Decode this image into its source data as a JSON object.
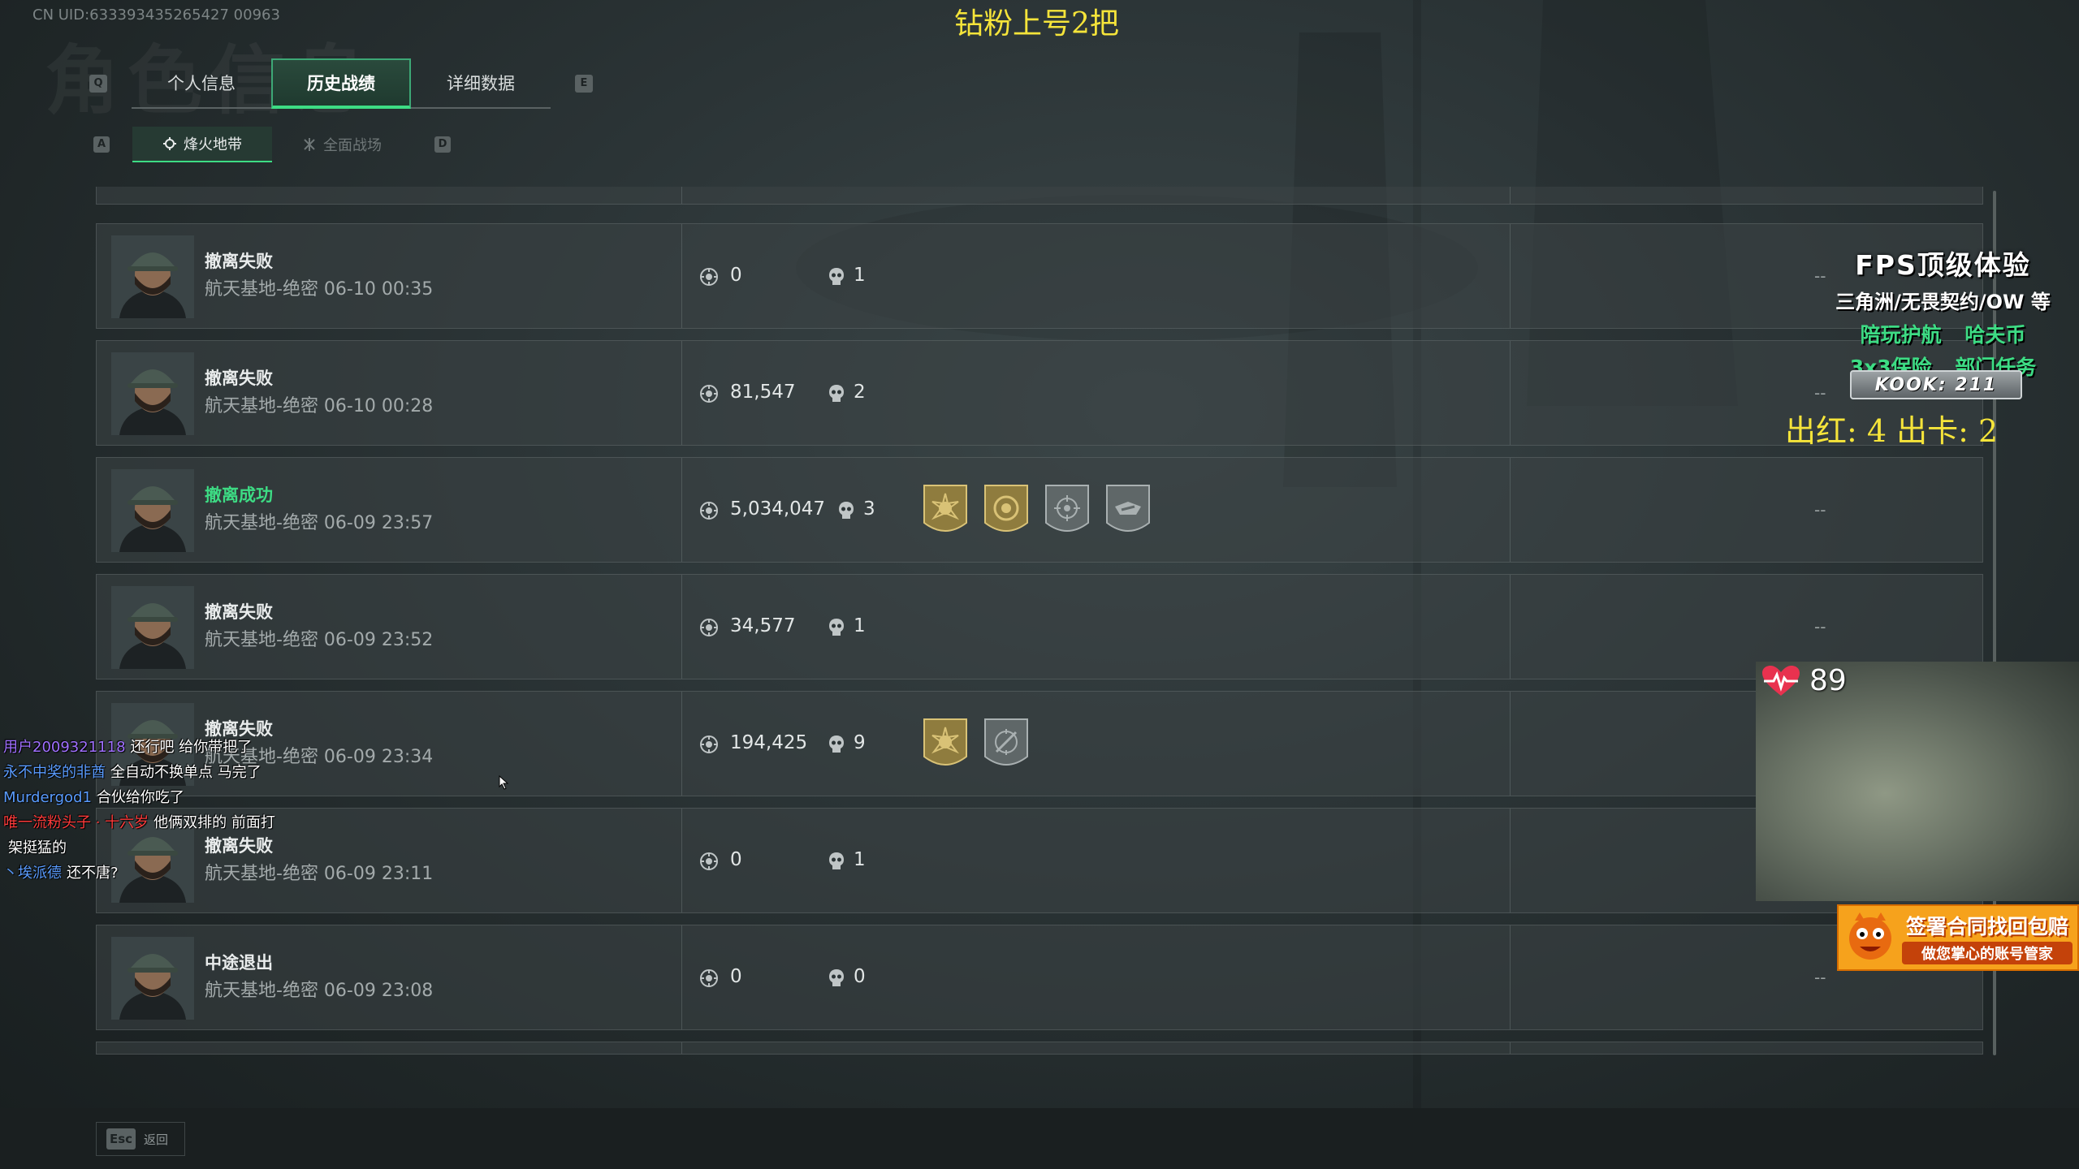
{
  "uid": "CN UID:633393435265427 00963",
  "bg_title": "角色信息",
  "stream_title": "钻粉上号2把",
  "tabs": {
    "prev_key": "Q",
    "next_key": "E",
    "items": [
      {
        "label": "个人信息"
      },
      {
        "label": "历史战绩"
      },
      {
        "label": "详细数据"
      }
    ]
  },
  "subtabs": {
    "prev_key": "A",
    "next_key": "D",
    "items": [
      {
        "label": "烽火地带"
      },
      {
        "label": "全面战场"
      }
    ]
  },
  "records": [
    {
      "status": "撤离失败",
      "detail": "航天基地-绝密 06-10 00:35",
      "value": "0",
      "kills": "1",
      "result": "--"
    },
    {
      "status": "撤离失败",
      "detail": "航天基地-绝密 06-10 00:28",
      "value": "81,547",
      "kills": "2",
      "result": "--"
    },
    {
      "status": "撤离成功",
      "detail": "航天基地-绝密 06-09 23:57",
      "value": "5,034,047",
      "kills": "3",
      "result": "--"
    },
    {
      "status": "撤离失败",
      "detail": "航天基地-绝密 06-09 23:52",
      "value": "34,577",
      "kills": "1",
      "result": "--"
    },
    {
      "status": "撤离失败",
      "detail": "航天基地-绝密 06-09 23:34",
      "value": "194,425",
      "kills": "9",
      "result": "--"
    },
    {
      "status": "撤离失败",
      "detail": "航天基地-绝密 06-09 23:11",
      "value": "0",
      "kills": "1",
      "result": "--"
    },
    {
      "status": "中途退出",
      "detail": "航天基地-绝密 06-09 23:08",
      "value": "0",
      "kills": "0",
      "result": "--"
    }
  ],
  "footer": {
    "esc_key": "Esc",
    "back_label": "返回"
  },
  "overlay": {
    "promo_line1": "FPS顶级体验",
    "promo_line2": "三角洲/无畏契约/OW 等",
    "promo_line3": "陪玩护航 哈夫币",
    "promo_line4": "3x3保险 部门任务",
    "kook": "KOOK: 211",
    "counter": "出红: 4 出卡: 2",
    "heart_rate": "89",
    "ad_line1": "签署合同找回包赔",
    "ad_line2": "做您掌心的账号管家"
  },
  "chat": [
    {
      "user": "用户2009321118",
      "msg": "还行吧 给你带把了",
      "color": "#a070ff"
    },
    {
      "user": "永不中奖的非酋",
      "msg": "全自动不换单点 马完了",
      "color": "#5a9cff"
    },
    {
      "user": "Murdergod1",
      "msg": "合伙给你吃了",
      "color": "#5a9cff"
    },
    {
      "user": "唯一流粉头子 · 十六岁",
      "msg": "他俩双排的 前面打",
      "color": "#ff3b3b"
    },
    {
      "user": "",
      "msg": "架挺猛的",
      "color": "#ffffff"
    },
    {
      "user": "丶埃派德",
      "msg": "还不唐?",
      "color": "#5a9cff"
    }
  ],
  "colors": {
    "accent": "#3ddc84",
    "title_yellow": "#f5e43a",
    "badge_gold": "#b8a25a",
    "badge_gray": "#7c8485"
  }
}
